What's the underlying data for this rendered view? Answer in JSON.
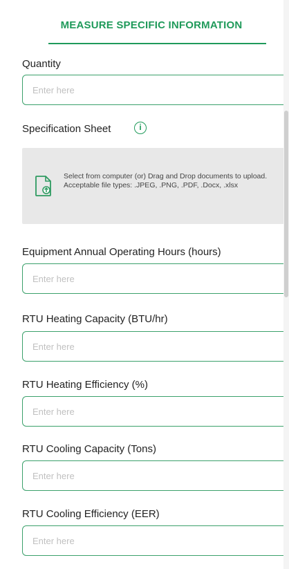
{
  "section": {
    "title": "MEASURE SPECIFIC INFORMATION"
  },
  "quantity": {
    "label": "Quantity",
    "placeholder": "Enter here"
  },
  "spec_sheet": {
    "label": "Specification Sheet",
    "info_icon": "info-icon",
    "upload_text": "Select from computer (or) Drag and Drop documents to upload. Acceptable file types: .JPEG, .PNG, .PDF, .Docx, .xlsx",
    "upload_icon": "document-upload-icon"
  },
  "fields": [
    {
      "label": "Equipment Annual Operating Hours (hours)",
      "placeholder": "Enter here"
    },
    {
      "label": "RTU Heating Capacity (BTU/hr)",
      "placeholder": "Enter here"
    },
    {
      "label": "RTU Heating Efficiency (%)",
      "placeholder": "Enter here"
    },
    {
      "label": "RTU Cooling Capacity (Tons)",
      "placeholder": "Enter here"
    },
    {
      "label": "RTU Cooling Efficiency (EER)",
      "placeholder": "Enter here"
    }
  ],
  "colors": {
    "accent": "#1f9a5a",
    "upload_bg": "#e8e8e8"
  }
}
